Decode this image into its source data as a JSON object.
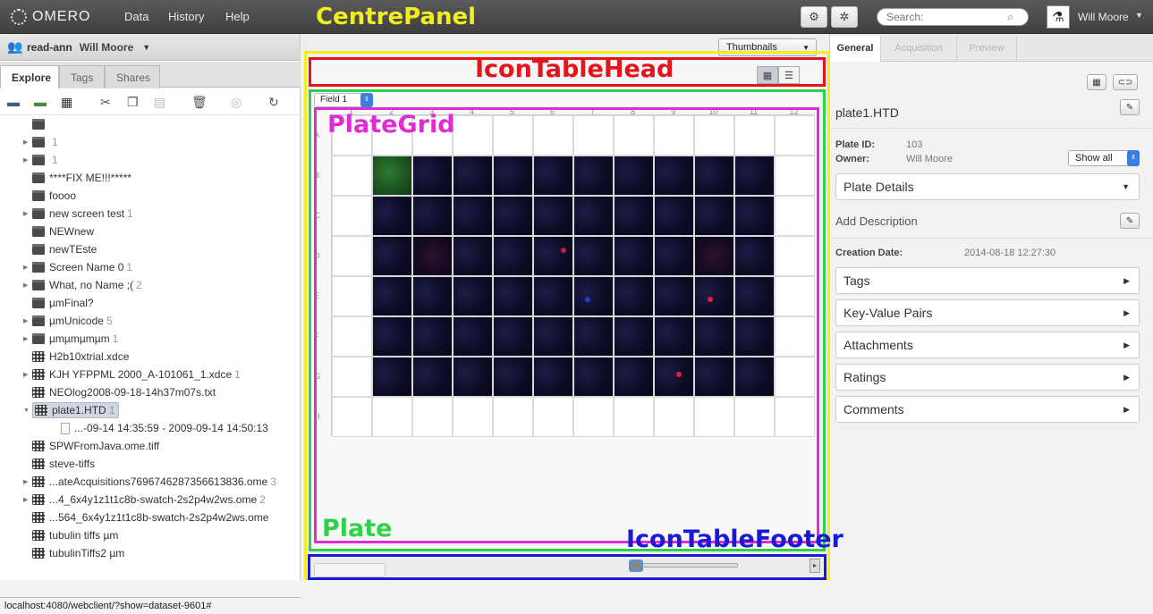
{
  "topbar": {
    "logo_text": "OMERO",
    "nav": [
      "Data",
      "History",
      "Help"
    ],
    "search_placeholder": "Search:",
    "user_name": "Will Moore"
  },
  "left": {
    "group": {
      "name": "read-ann",
      "user": "Will Moore"
    },
    "tabs": [
      "Explore",
      "Tags",
      "Shares"
    ],
    "tree": [
      {
        "label": "",
        "icon": "screen-icon",
        "arrow": false,
        "count": ""
      },
      {
        "label": "",
        "icon": "screen-icon",
        "arrow": true,
        "count": "1"
      },
      {
        "label": "",
        "icon": "screen-icon",
        "arrow": true,
        "count": "1"
      },
      {
        "label": "****FIX ME!!!*****",
        "icon": "screen-icon",
        "arrow": false,
        "count": ""
      },
      {
        "label": "foooo",
        "icon": "screen-icon",
        "arrow": false,
        "count": ""
      },
      {
        "label": "new screen test",
        "icon": "screen-icon",
        "arrow": true,
        "count": "1"
      },
      {
        "label": "NEWnew",
        "icon": "screen-icon",
        "arrow": false,
        "count": ""
      },
      {
        "label": "newTEste",
        "icon": "screen-icon",
        "arrow": false,
        "count": ""
      },
      {
        "label": "Screen Name 0",
        "icon": "screen-icon",
        "arrow": true,
        "count": "1"
      },
      {
        "label": "What, no Name ;(",
        "icon": "screen-icon",
        "arrow": true,
        "count": "2"
      },
      {
        "label": "µmFinal?",
        "icon": "screen-icon",
        "arrow": false,
        "count": ""
      },
      {
        "label": "µmUnicode",
        "icon": "screen-icon",
        "arrow": true,
        "count": "5"
      },
      {
        "label": "µmµmµmµm",
        "icon": "screen-icon",
        "arrow": true,
        "count": "1"
      },
      {
        "label": "H2b10xtrial.xdce",
        "icon": "plate-icon",
        "arrow": false,
        "count": ""
      },
      {
        "label": "KJH YFPPML 2000_A-101061_1.xdce",
        "icon": "plate-icon",
        "arrow": true,
        "count": "1"
      },
      {
        "label": "NEOlog2008-09-18-14h37m07s.txt",
        "icon": "plate-icon",
        "arrow": false,
        "count": ""
      },
      {
        "label": "plate1.HTD",
        "icon": "plate-icon",
        "arrow": true,
        "count": "1",
        "selected": true
      },
      {
        "label": "...-09-14 14:35:59 - 2009-09-14 14:50:13",
        "icon": "file-icon",
        "arrow": false,
        "count": "",
        "indent": 2
      },
      {
        "label": "SPWFromJava.ome.tiff",
        "icon": "plate-icon",
        "arrow": false,
        "count": ""
      },
      {
        "label": "steve-tiffs",
        "icon": "plate-icon",
        "arrow": false,
        "count": ""
      },
      {
        "label": "...ateAcquisitions7696746287356613836.ome",
        "icon": "plate-icon",
        "arrow": true,
        "count": "3"
      },
      {
        "label": "...4_6x4y1z1t1c8b-swatch-2s2p4w2ws.ome",
        "icon": "plate-icon",
        "arrow": true,
        "count": "2"
      },
      {
        "label": "...564_6x4y1z1t1c8b-swatch-2s2p4w2ws.ome",
        "icon": "plate-icon",
        "arrow": false,
        "count": ""
      },
      {
        "label": "tubulin tiffs µm",
        "icon": "plate-icon",
        "arrow": false,
        "count": ""
      },
      {
        "label": "tubulinTiffs2 µm",
        "icon": "plate-icon",
        "arrow": false,
        "count": ""
      }
    ],
    "status_url": "localhost:4080/webclient/?show=dataset-9601#"
  },
  "centre": {
    "view_select": "Thumbnails",
    "field_select": "Field 1",
    "columns": [
      "1",
      "2",
      "3",
      "4",
      "5",
      "6",
      "7",
      "8",
      "9",
      "10",
      "11",
      "12"
    ],
    "rows": [
      "A",
      "B",
      "C",
      "D",
      "E",
      "F",
      "G",
      "H"
    ],
    "image_rows": [
      1,
      2,
      3,
      4,
      5,
      6
    ],
    "image_cols": [
      1,
      2,
      3,
      4,
      5,
      6,
      7,
      8,
      9,
      10
    ]
  },
  "annotations": {
    "centre_panel": {
      "label": "CentrePanel",
      "color": "#f2ee1c"
    },
    "icon_table_head": {
      "label": "IconTableHead",
      "color": "#e3141c"
    },
    "plate": {
      "label": "Plate",
      "color": "#2fd14a"
    },
    "plate_grid": {
      "label": "PlateGrid",
      "color": "#e02bd4"
    },
    "icon_table_footer": {
      "label": "IconTableFooter",
      "color": "#1a1ad6"
    }
  },
  "right": {
    "tabs": [
      "General",
      "Acquisition",
      "Preview"
    ],
    "object_name": "plate1.HTD",
    "plate_id_label": "Plate ID:",
    "plate_id": "103",
    "owner_label": "Owner:",
    "owner": "Will Moore",
    "show_all": "Show all",
    "plate_details": "Plate Details",
    "add_description": "Add Description",
    "creation_label": "Creation Date:",
    "creation_date": "2014-08-18 12:27:30",
    "sections": [
      "Tags",
      "Key-Value Pairs",
      "Attachments",
      "Ratings",
      "Comments"
    ]
  }
}
